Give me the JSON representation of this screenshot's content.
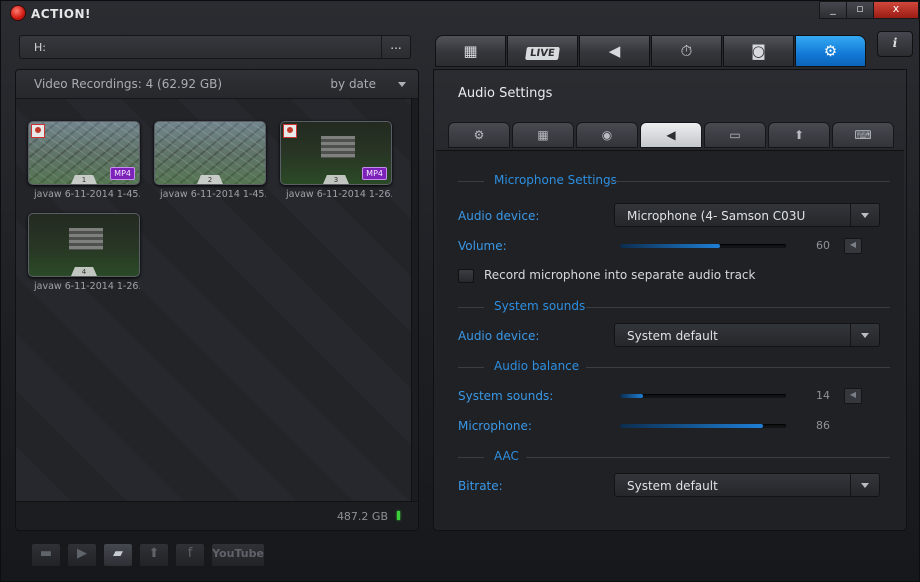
{
  "app": {
    "title": "ACTION!"
  },
  "window_buttons": {
    "minimize": "_",
    "maximize": "▫",
    "close": "x"
  },
  "path_bar": {
    "path": "H:",
    "more": "..."
  },
  "recordings": {
    "title": "Video Recordings: 4 (62.92 GB)",
    "sort": "by date",
    "disk_free": "487.2 GB",
    "items": [
      {
        "index": "1",
        "caption": "javaw 6-11-2014 1-45...",
        "format": "MP4"
      },
      {
        "index": "2",
        "caption": "javaw 6-11-2014 1-45...",
        "format": ""
      },
      {
        "index": "3",
        "caption": "javaw 6-11-2014 1-26...",
        "format": "MP4"
      },
      {
        "index": "4",
        "caption": "javaw 6-11-2014 1-26...",
        "format": ""
      }
    ]
  },
  "bottom_toolbar": {
    "youtube_label": "YouTube",
    "facebook_label": "f",
    "icons": [
      "stop-icon",
      "play-icon",
      "folder-icon",
      "upload-icon",
      "facebook-icon",
      "youtube-icon"
    ]
  },
  "main_tabs": [
    {
      "icon": "film-icon"
    },
    {
      "icon": "live-icon",
      "label": "LIVE"
    },
    {
      "icon": "speaker-icon"
    },
    {
      "icon": "stopwatch-icon"
    },
    {
      "icon": "camera-icon"
    },
    {
      "icon": "gear-icon",
      "active": true
    }
  ],
  "info_button": "i",
  "settings": {
    "title": "Audio Settings",
    "sub_tabs": [
      {
        "icon": "gear-icon"
      },
      {
        "icon": "film-icon"
      },
      {
        "icon": "webcam-icon"
      },
      {
        "icon": "speaker-icon",
        "active": true
      },
      {
        "icon": "monitor-icon"
      },
      {
        "icon": "upload-icon"
      },
      {
        "icon": "keyboard-icon"
      }
    ],
    "microphone_section": "Microphone Settings",
    "mic_device_label": "Audio device:",
    "mic_device_value": "Microphone (4- Samson C03U",
    "volume_label": "Volume:",
    "volume_value": "60",
    "record_separate_label": "Record microphone into separate audio track",
    "system_section": "System sounds",
    "sys_device_label": "Audio device:",
    "sys_device_value": "System default",
    "balance_section": "Audio balance",
    "system_sounds_label": "System sounds:",
    "system_sounds_value": "14",
    "microphone_label": "Microphone:",
    "microphone_value": "86",
    "aac_section": "AAC",
    "bitrate_label": "Bitrate:",
    "bitrate_value": "System default"
  },
  "colors": {
    "accent": "#1e8ee6",
    "format_badge": "#7c22b8",
    "close": "#c0392b"
  }
}
